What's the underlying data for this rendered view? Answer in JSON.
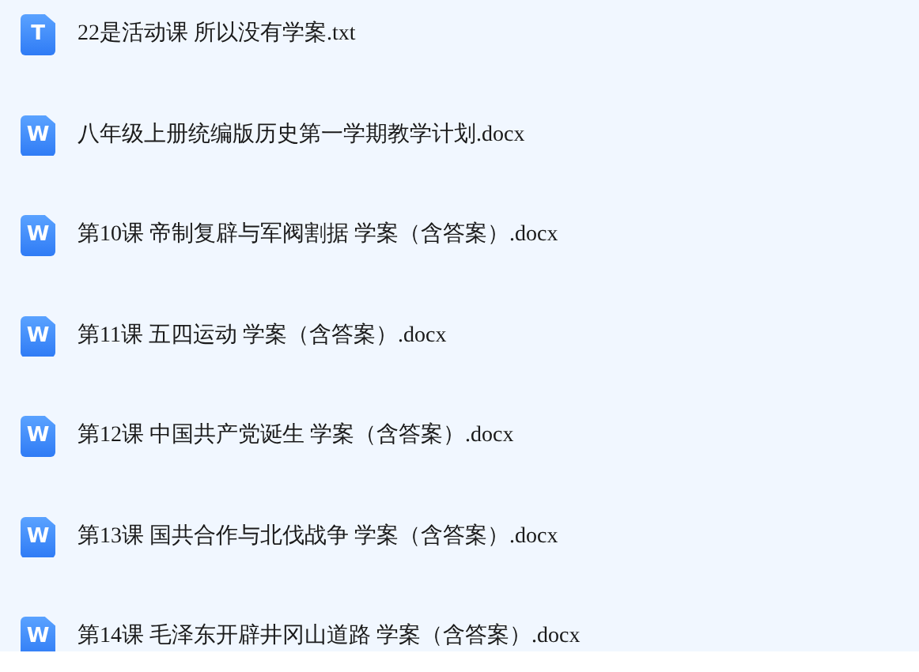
{
  "files": [
    {
      "icon_letter": "T",
      "name": "22是活动课 所以没有学案.txt"
    },
    {
      "icon_letter": "W",
      "name": "八年级上册统编版历史第一学期教学计划.docx"
    },
    {
      "icon_letter": "W",
      "name": "第10课 帝制复辟与军阀割据 学案（含答案）.docx"
    },
    {
      "icon_letter": "W",
      "name": "第11课 五四运动 学案（含答案）.docx"
    },
    {
      "icon_letter": "W",
      "name": "第12课 中国共产党诞生 学案（含答案）.docx"
    },
    {
      "icon_letter": "W",
      "name": "第13课 国共合作与北伐战争 学案（含答案）.docx"
    },
    {
      "icon_letter": "W",
      "name": "第14课 毛泽东开辟井冈山道路 学案（含答案）.docx"
    }
  ]
}
